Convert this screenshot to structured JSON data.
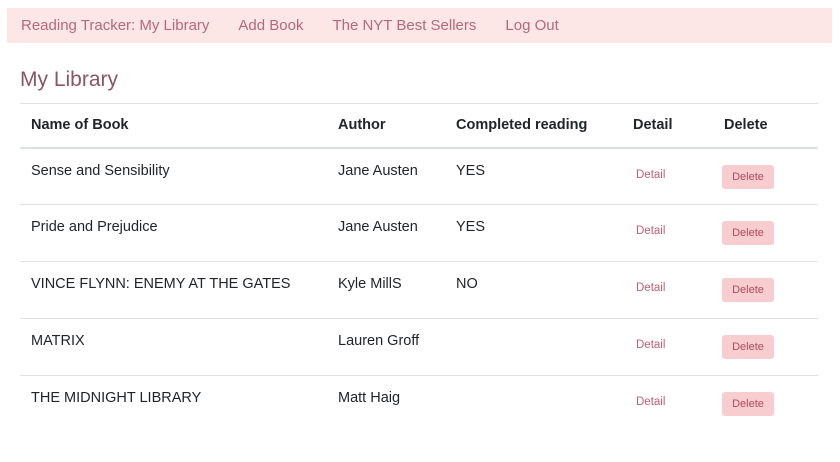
{
  "navbar": {
    "brand": "Reading Tracker: My Library",
    "links": [
      "Add Book",
      "The NYT Best Sellers",
      "Log Out"
    ]
  },
  "page": {
    "title": "My Library"
  },
  "table": {
    "headers": [
      "Name of Book",
      "Author",
      "Completed reading",
      "Detail",
      "Delete"
    ],
    "rows": [
      {
        "name": "Sense and Sensibility",
        "author": "Jane Austen",
        "completed": "YES",
        "detail": "Detail",
        "delete": "Delete"
      },
      {
        "name": "Pride and Prejudice",
        "author": "Jane Austen",
        "completed": "YES",
        "detail": "Detail",
        "delete": "Delete"
      },
      {
        "name": "VINCE FLYNN: ENEMY AT THE GATES",
        "author": "Kyle MillS",
        "completed": "NO",
        "detail": "Detail",
        "delete": "Delete"
      },
      {
        "name": "MATRIX",
        "author": "Lauren Groff",
        "completed": "",
        "detail": "Detail",
        "delete": "Delete"
      },
      {
        "name": "THE MIDNIGHT LIBRARY",
        "author": "Matt Haig",
        "completed": "",
        "detail": "Detail",
        "delete": "Delete"
      }
    ]
  },
  "colors": {
    "navbar_bg": "#fde6e6",
    "nav_link": "#b46a78",
    "title": "#8a5566",
    "detail_link": "#c25d72",
    "delete_bg": "#f8cdcf",
    "delete_text": "#b04a60"
  }
}
